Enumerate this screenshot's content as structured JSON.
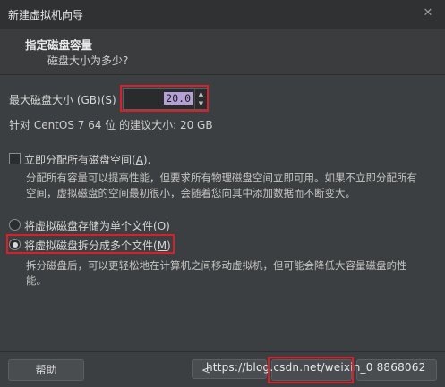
{
  "window": {
    "title": "新建虚拟机向导",
    "close_label": "✕"
  },
  "header": {
    "title": "指定磁盘容量",
    "subtitle": "磁盘大小为多少?"
  },
  "disk_size": {
    "label_prefix": "最大磁盘大小 (GB)(",
    "label_key": "S",
    "label_suffix": ")",
    "value": "20.0",
    "recommend": "针对 CentOS 7 64 位 的建议大小: 20 GB"
  },
  "allocate": {
    "label_prefix": "立即分配所有磁盘空间(",
    "label_key": "A",
    "label_suffix": ").",
    "checked": false,
    "desc_line1": "分配所有容量可以提高性能，但要求所有物理磁盘空间立即可用。如果不立即分配所有",
    "desc_line2": "空间，虚拟磁盘的空间最初很小，会随着您向其中添加数据而不断变大。"
  },
  "storage": {
    "single_prefix": "将虚拟磁盘存储为单个文件(",
    "single_key": "O",
    "single_suffix": ")",
    "multi_prefix": "将虚拟磁盘拆分成多个文件(",
    "multi_key": "M",
    "multi_suffix": ")",
    "selected": "multi",
    "desc_line1": "拆分磁盘后，可以更轻松地在计算机之间移动虚拟机，但可能会降低大容量磁盘的性",
    "desc_line2": "能。"
  },
  "footer": {
    "help_label": "帮助",
    "back_label": "<",
    "watermark": "https://blog.csdn.net/weixin_0 8868062"
  },
  "colors": {
    "highlight": "#d8202a",
    "background": "#3c3f41",
    "selection": "#b4a0d6"
  },
  "icons": {
    "close": "close-icon",
    "spin_up": "chevron-up-icon",
    "spin_down": "chevron-down-icon"
  }
}
